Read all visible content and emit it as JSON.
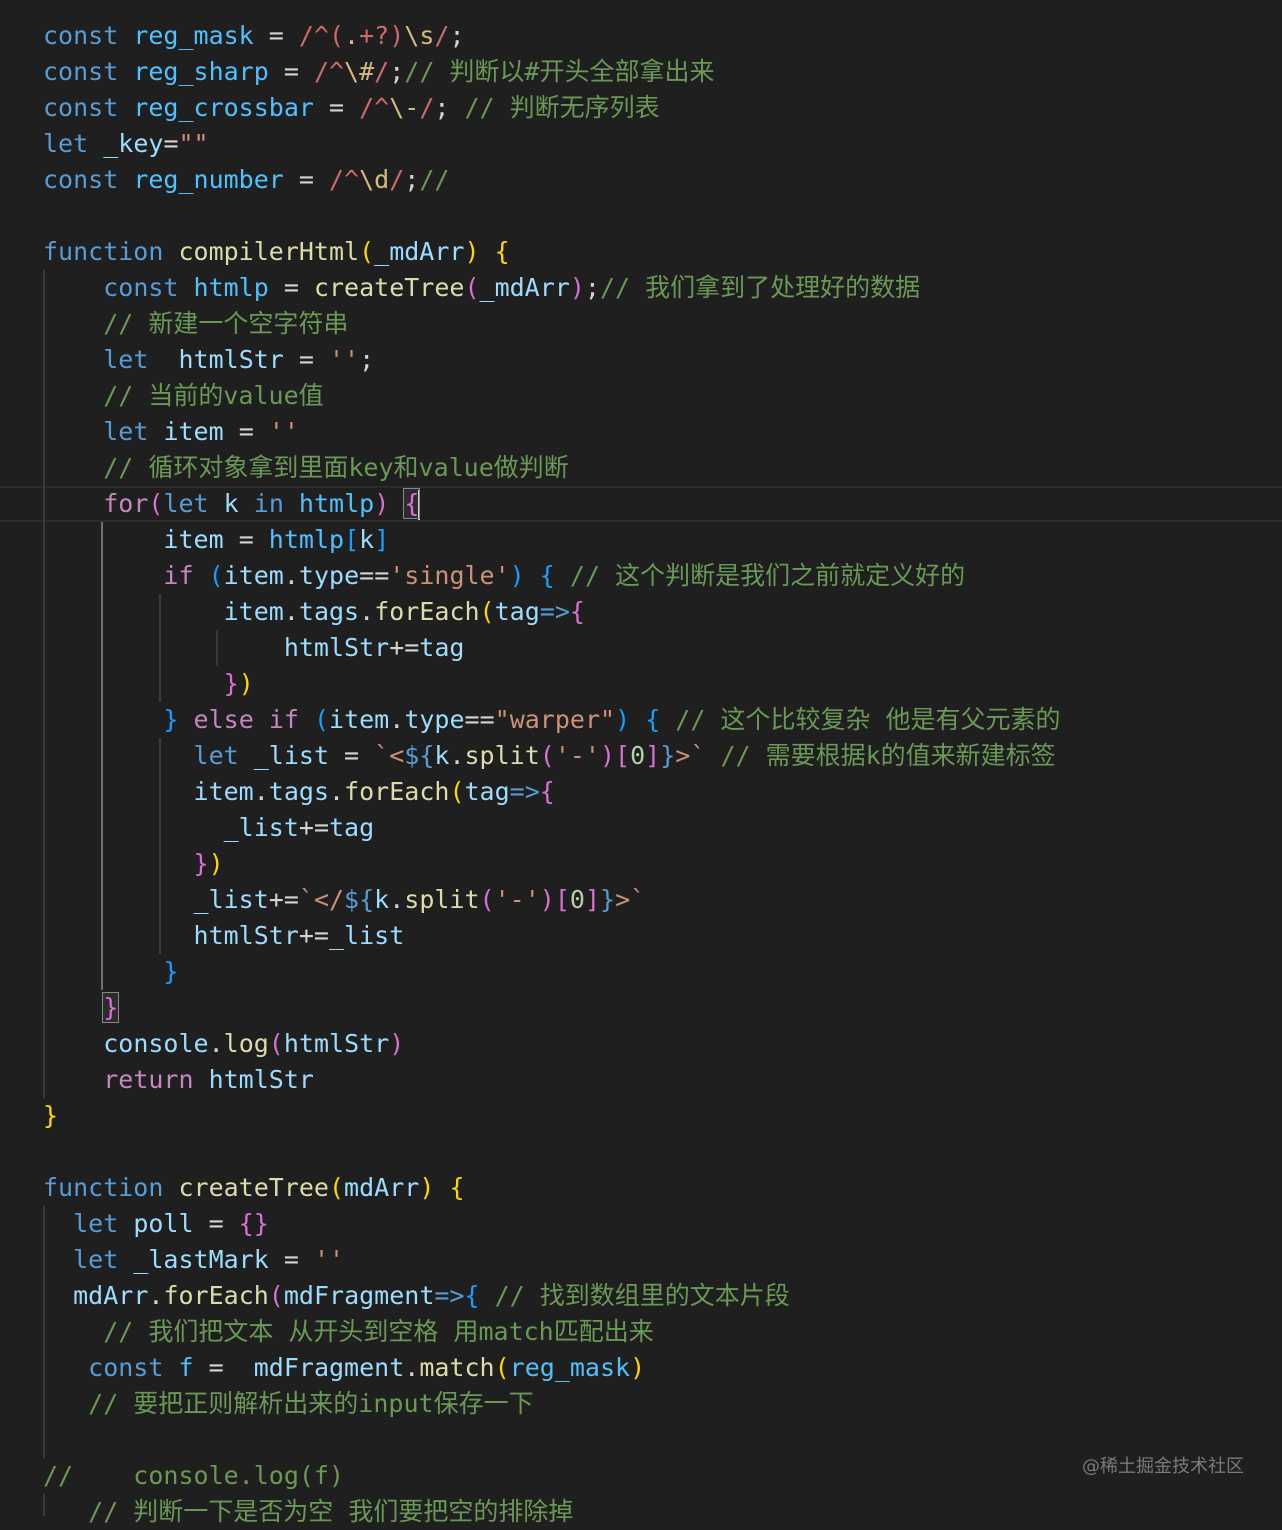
{
  "editor": {
    "theme": "dark",
    "colors": {
      "background": "#1f1f1f",
      "keyword": "#569cd6",
      "control": "#c586c0",
      "variable": "#9cdcfe",
      "constant": "#4fc1ff",
      "function": "#dcdcaa",
      "string": "#ce9178",
      "regex": "#d16969",
      "comment": "#6a9955",
      "bracket_gold": "#ffd700",
      "bracket_purple": "#da70d6",
      "bracket_blue": "#179fff"
    },
    "lines": [
      [
        [
          "const ",
          "kw"
        ],
        [
          "reg_mask",
          "cst"
        ],
        [
          " = ",
          "pl"
        ],
        [
          "/^(",
          "rx"
        ],
        [
          ".",
          "esc"
        ],
        [
          "+?)",
          "rx"
        ],
        [
          "\\s",
          "esc"
        ],
        [
          "/",
          "rx"
        ],
        [
          ";",
          "pl"
        ]
      ],
      [
        [
          "const ",
          "kw"
        ],
        [
          "reg_sharp",
          "cst"
        ],
        [
          " = ",
          "pl"
        ],
        [
          "/^",
          "rx"
        ],
        [
          "\\#",
          "esc"
        ],
        [
          "/",
          "rx"
        ],
        [
          ";",
          "pl"
        ],
        [
          "// 判断以#开头全部拿出来",
          "cmt"
        ]
      ],
      [
        [
          "const ",
          "kw"
        ],
        [
          "reg_crossbar",
          "cst"
        ],
        [
          " = ",
          "pl"
        ],
        [
          "/^",
          "rx"
        ],
        [
          "\\-",
          "esc"
        ],
        [
          "/",
          "rx"
        ],
        [
          "; ",
          "pl"
        ],
        [
          "// 判断无序列表",
          "cmt"
        ]
      ],
      [
        [
          "let ",
          "kw"
        ],
        [
          "_key",
          "var"
        ],
        [
          "=",
          "pl"
        ],
        [
          "\"\"",
          "str"
        ]
      ],
      [
        [
          "const ",
          "kw"
        ],
        [
          "reg_number",
          "cst"
        ],
        [
          " = ",
          "pl"
        ],
        [
          "/^",
          "rx"
        ],
        [
          "\\d",
          "esc"
        ],
        [
          "/",
          "rx"
        ],
        [
          ";",
          "pl"
        ],
        [
          "//",
          "cmt"
        ]
      ],
      [],
      [
        [
          "function ",
          "kw"
        ],
        [
          "compilerHtml",
          "fn"
        ],
        [
          "(",
          "b1"
        ],
        [
          "_mdArr",
          "var"
        ],
        [
          ")",
          "b1"
        ],
        [
          " ",
          "pl"
        ],
        [
          "{",
          "b1"
        ]
      ],
      [
        [
          "    ",
          "pl"
        ],
        [
          "const ",
          "kw"
        ],
        [
          "htmlp",
          "cst"
        ],
        [
          " = ",
          "pl"
        ],
        [
          "createTree",
          "fn"
        ],
        [
          "(",
          "b2"
        ],
        [
          "_mdArr",
          "var"
        ],
        [
          ")",
          "b2"
        ],
        [
          ";",
          "pl"
        ],
        [
          "// 我们拿到了处理好的数据",
          "cmt"
        ]
      ],
      [
        [
          "    ",
          "pl"
        ],
        [
          "// 新建一个空字符串",
          "cmt"
        ]
      ],
      [
        [
          "    ",
          "pl"
        ],
        [
          "let  ",
          "kw"
        ],
        [
          "htmlStr",
          "var"
        ],
        [
          " = ",
          "pl"
        ],
        [
          "''",
          "str"
        ],
        [
          ";",
          "pl"
        ]
      ],
      [
        [
          "    ",
          "pl"
        ],
        [
          "// 当前的value值",
          "cmt"
        ]
      ],
      [
        [
          "    ",
          "pl"
        ],
        [
          "let ",
          "kw"
        ],
        [
          "item",
          "var"
        ],
        [
          " = ",
          "pl"
        ],
        [
          "''",
          "str"
        ]
      ],
      [
        [
          "    ",
          "pl"
        ],
        [
          "// 循环对象拿到里面key和value做判断",
          "cmt"
        ]
      ],
      [
        [
          "    ",
          "pl"
        ],
        [
          "for",
          "ctl"
        ],
        [
          "(",
          "b2"
        ],
        [
          "let ",
          "kw"
        ],
        [
          "k ",
          "var"
        ],
        [
          "in ",
          "kw"
        ],
        [
          "htmlp",
          "cst"
        ],
        [
          ")",
          "b2"
        ],
        [
          " ",
          "pl"
        ],
        [
          "{",
          "b2 match"
        ],
        [
          "|",
          "cursor"
        ]
      ],
      [
        [
          "        ",
          "pl"
        ],
        [
          "item",
          "var"
        ],
        [
          " = ",
          "pl"
        ],
        [
          "htmlp",
          "cst"
        ],
        [
          "[",
          "b3"
        ],
        [
          "k",
          "var"
        ],
        [
          "]",
          "b3"
        ]
      ],
      [
        [
          "        ",
          "pl"
        ],
        [
          "if ",
          "ctl"
        ],
        [
          "(",
          "b3"
        ],
        [
          "item",
          "var"
        ],
        [
          ".",
          "pl"
        ],
        [
          "type",
          "var"
        ],
        [
          "==",
          "pl"
        ],
        [
          "'single'",
          "str"
        ],
        [
          ")",
          "b3"
        ],
        [
          " ",
          "pl"
        ],
        [
          "{",
          "b3"
        ],
        [
          " // 这个判断是我们之前就定义好的",
          "cmt"
        ]
      ],
      [
        [
          "            ",
          "pl"
        ],
        [
          "item",
          "var"
        ],
        [
          ".",
          "pl"
        ],
        [
          "tags",
          "var"
        ],
        [
          ".",
          "pl"
        ],
        [
          "forEach",
          "fn"
        ],
        [
          "(",
          "b1"
        ],
        [
          "tag",
          "var"
        ],
        [
          "=>",
          "kw"
        ],
        [
          "{",
          "b2"
        ]
      ],
      [
        [
          "                ",
          "pl"
        ],
        [
          "htmlStr",
          "var"
        ],
        [
          "+=",
          "pl"
        ],
        [
          "tag",
          "var"
        ]
      ],
      [
        [
          "            ",
          "pl"
        ],
        [
          "}",
          "b2"
        ],
        [
          ")",
          "b1"
        ]
      ],
      [
        [
          "        ",
          "pl"
        ],
        [
          "}",
          "b3"
        ],
        [
          " ",
          "pl"
        ],
        [
          "else ",
          "ctl"
        ],
        [
          "if ",
          "ctl"
        ],
        [
          "(",
          "b3"
        ],
        [
          "item",
          "var"
        ],
        [
          ".",
          "pl"
        ],
        [
          "type",
          "var"
        ],
        [
          "==",
          "pl"
        ],
        [
          "\"warper\"",
          "str"
        ],
        [
          ")",
          "b3"
        ],
        [
          " ",
          "pl"
        ],
        [
          "{",
          "b3"
        ],
        [
          " // 这个比较复杂 他是有父元素的",
          "cmt"
        ]
      ],
      [
        [
          "          ",
          "pl"
        ],
        [
          "let ",
          "kw"
        ],
        [
          "_list",
          "var"
        ],
        [
          " = ",
          "pl"
        ],
        [
          "`<",
          "str"
        ],
        [
          "${",
          "tpl"
        ],
        [
          "k",
          "var"
        ],
        [
          ".",
          "pl"
        ],
        [
          "split",
          "fn"
        ],
        [
          "(",
          "b2"
        ],
        [
          "'-'",
          "str"
        ],
        [
          ")",
          "b2"
        ],
        [
          "[",
          "b2"
        ],
        [
          "0",
          "num"
        ],
        [
          "]",
          "b2"
        ],
        [
          "}",
          "tpl"
        ],
        [
          ">`",
          "str"
        ],
        [
          " // 需要根据k的值来新建标签",
          "cmt"
        ]
      ],
      [
        [
          "          ",
          "pl"
        ],
        [
          "item",
          "var"
        ],
        [
          ".",
          "pl"
        ],
        [
          "tags",
          "var"
        ],
        [
          ".",
          "pl"
        ],
        [
          "forEach",
          "fn"
        ],
        [
          "(",
          "b1"
        ],
        [
          "tag",
          "var"
        ],
        [
          "=>",
          "kw"
        ],
        [
          "{",
          "b2"
        ]
      ],
      [
        [
          "            ",
          "pl"
        ],
        [
          "_list",
          "var"
        ],
        [
          "+=",
          "pl"
        ],
        [
          "tag",
          "var"
        ]
      ],
      [
        [
          "          ",
          "pl"
        ],
        [
          "}",
          "b2"
        ],
        [
          ")",
          "b1"
        ]
      ],
      [
        [
          "          ",
          "pl"
        ],
        [
          "_list",
          "var"
        ],
        [
          "+=",
          "pl"
        ],
        [
          "`</",
          "str"
        ],
        [
          "${",
          "tpl"
        ],
        [
          "k",
          "var"
        ],
        [
          ".",
          "pl"
        ],
        [
          "split",
          "fn"
        ],
        [
          "(",
          "b2"
        ],
        [
          "'-'",
          "str"
        ],
        [
          ")",
          "b2"
        ],
        [
          "[",
          "b2"
        ],
        [
          "0",
          "num"
        ],
        [
          "]",
          "b2"
        ],
        [
          "}",
          "tpl"
        ],
        [
          ">`",
          "str"
        ]
      ],
      [
        [
          "          ",
          "pl"
        ],
        [
          "htmlStr",
          "var"
        ],
        [
          "+=",
          "pl"
        ],
        [
          "_list",
          "var"
        ]
      ],
      [
        [
          "        ",
          "pl"
        ],
        [
          "}",
          "b3"
        ]
      ],
      [
        [
          "    ",
          "pl"
        ],
        [
          "}",
          "b2 match"
        ]
      ],
      [
        [
          "    ",
          "pl"
        ],
        [
          "console",
          "var"
        ],
        [
          ".",
          "pl"
        ],
        [
          "log",
          "fn"
        ],
        [
          "(",
          "b2"
        ],
        [
          "htmlStr",
          "var"
        ],
        [
          ")",
          "b2"
        ]
      ],
      [
        [
          "    ",
          "pl"
        ],
        [
          "return ",
          "ctl"
        ],
        [
          "htmlStr",
          "var"
        ]
      ],
      [
        [
          "}",
          "b1"
        ]
      ],
      [],
      [
        [
          "function ",
          "kw"
        ],
        [
          "createTree",
          "fn"
        ],
        [
          "(",
          "b1"
        ],
        [
          "mdArr",
          "var"
        ],
        [
          ")",
          "b1"
        ],
        [
          " ",
          "pl"
        ],
        [
          "{",
          "b1"
        ]
      ],
      [
        [
          "  ",
          "pl"
        ],
        [
          "let ",
          "kw"
        ],
        [
          "poll",
          "var"
        ],
        [
          " = ",
          "pl"
        ],
        [
          "{}",
          "b2"
        ]
      ],
      [
        [
          "  ",
          "pl"
        ],
        [
          "let ",
          "kw"
        ],
        [
          "_lastMark",
          "var"
        ],
        [
          " = ",
          "pl"
        ],
        [
          "''",
          "str"
        ]
      ],
      [
        [
          "  ",
          "pl"
        ],
        [
          "mdArr",
          "var"
        ],
        [
          ".",
          "pl"
        ],
        [
          "forEach",
          "fn"
        ],
        [
          "(",
          "b2"
        ],
        [
          "mdFragment",
          "var"
        ],
        [
          "=>",
          "kw"
        ],
        [
          "{",
          "b3"
        ],
        [
          " // 找到数组里的文本片段",
          "cmt"
        ]
      ],
      [
        [
          "    ",
          "pl"
        ],
        [
          "// 我们把文本 从开头到空格 用match匹配出来",
          "cmt"
        ]
      ],
      [
        [
          "   ",
          "pl"
        ],
        [
          "const ",
          "kw"
        ],
        [
          "f",
          "cst"
        ],
        [
          " =  ",
          "pl"
        ],
        [
          "mdFragment",
          "var"
        ],
        [
          ".",
          "pl"
        ],
        [
          "match",
          "fn"
        ],
        [
          "(",
          "b1"
        ],
        [
          "reg_mask",
          "cst"
        ],
        [
          ")",
          "b1"
        ]
      ],
      [
        [
          "   ",
          "pl"
        ],
        [
          "// 要把正则解析出来的input保存一下",
          "cmt"
        ]
      ],
      [],
      [
        [
          "//    console.log(f)",
          "cmt"
        ]
      ],
      [
        [
          "   ",
          "pl"
        ],
        [
          "// 判断一下是否为空 我们要把空的排除掉",
          "cmt"
        ]
      ]
    ]
  },
  "watermark": "@稀土掘金技术社区"
}
